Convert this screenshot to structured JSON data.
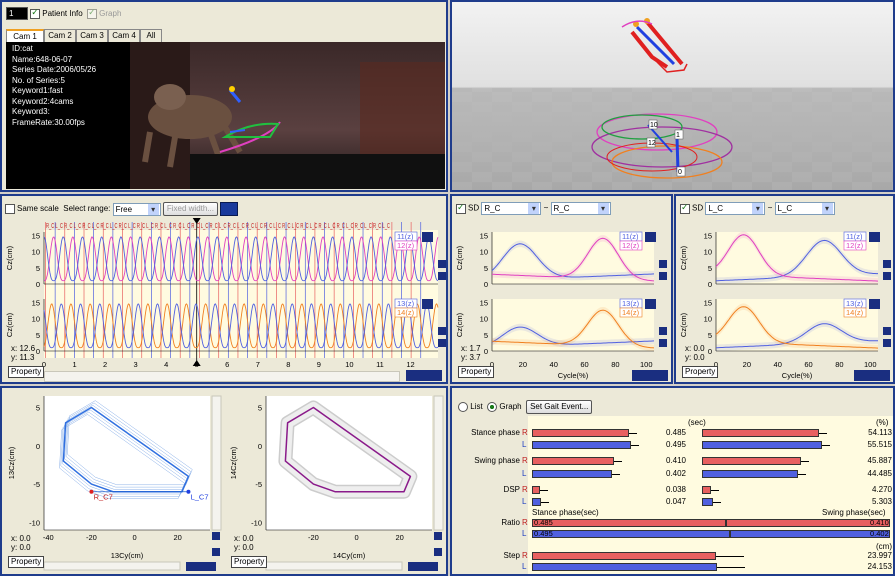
{
  "colors": {
    "accent": "#1f3c8c",
    "red": "#e86060",
    "blue": "#5060e0",
    "pink": "#e040c0",
    "orange": "#f08020",
    "green": "#20a040"
  },
  "topleft": {
    "cam_num": "1",
    "patient_info": "Patient Info",
    "graph": "Graph",
    "tabs": [
      "Cam 1",
      "Cam 2",
      "Cam 3",
      "Cam 4",
      "All"
    ],
    "info": [
      "ID:cat",
      "Name:648-06-07",
      "Series Date:2006/05/26",
      "No. of Series:5",
      "Keyword1:fast",
      "Keyword2:4cams",
      "Keyword3:",
      "FrameRate:30.00fps"
    ]
  },
  "topright": {
    "icons": [
      "refresh-icon",
      "move-icon",
      "down-arrow-icon",
      "cursor-icon"
    ],
    "labels": [
      "10",
      "1",
      "12",
      "0"
    ]
  },
  "timepane": {
    "same_scale": "Same scale",
    "select_range": "Select range:",
    "range_value": "Free",
    "fixed_width": "Fixed width...",
    "gait_label": "R_C L_C R_C L_C R_C L_C R_C L_C R_C L_C R_C L_C R_C L_C R_C L_C R_C L_C R_C L_C R_C L_C R_C L_C R_C L_C R_C L_C R_C L_C R_C L_C R_C L_C R_C L_C R_C L_C",
    "ylabel": "Cz(cm)",
    "xlabel": "Time(sec)",
    "legend_top": [
      "11(z)",
      "12(z)"
    ],
    "legend_bot": [
      "13(z)",
      "14(z)"
    ],
    "xticks": [
      "0",
      "1",
      "2",
      "3",
      "4",
      "5",
      "6",
      "7",
      "8",
      "9",
      "10",
      "11",
      "12"
    ],
    "yticks": [
      "15",
      "10",
      "5",
      "0"
    ],
    "x_readout": "x:  12.6",
    "y_readout": "y:  11.3",
    "property": "Property"
  },
  "cycleR": {
    "sd": "SD",
    "sel1": "R_C",
    "tilde": "~",
    "sel2": "R_C",
    "ylabel": "Cz(cm)",
    "xlabel": "Cycle(%)",
    "legend_top": [
      "11(z)",
      "12(z)"
    ],
    "legend_bot": [
      "13(z)",
      "14(z)"
    ],
    "xticks": [
      "0",
      "20",
      "40",
      "60",
      "80",
      "100"
    ],
    "yticks": [
      "15",
      "10",
      "5",
      "0"
    ],
    "x_readout": "x:  1.7",
    "y_readout": "y:  3.7",
    "property": "Property"
  },
  "cycleL": {
    "sd": "SD",
    "sel1": "L_C",
    "tilde": "~",
    "sel2": "L_C",
    "ylabel": "Cz(cm)",
    "xlabel": "Cycle(%)",
    "legend_top": [
      "11(z)",
      "12(z)"
    ],
    "legend_bot": [
      "13(z)",
      "14(z)"
    ],
    "xticks": [
      "0",
      "20",
      "40",
      "60",
      "80",
      "100"
    ],
    "yticks": [
      "15",
      "10",
      "5",
      "0"
    ],
    "x_readout": "x:  0.0",
    "y_readout": "y:  0.0",
    "property": "Property"
  },
  "loop1": {
    "ylabel": "13Cz(cm)",
    "xlabel": "13Cy(cm)",
    "xticks": [
      "-40",
      "-20",
      "0",
      "20"
    ],
    "yticks": [
      "5",
      "0",
      "-5",
      "-10"
    ],
    "label_r": "R_C7",
    "label_l": "L_C7",
    "x_readout": "x:  0.0",
    "y_readout": "y:  0.0",
    "property": "Property"
  },
  "loop2": {
    "ylabel": "14Cz(cm)",
    "xlabel": "14Cy(cm)",
    "xticks": [
      "-20",
      "0",
      "20"
    ],
    "yticks": [
      "5",
      "0",
      "-5",
      "-10"
    ],
    "x_readout": "x:  0.0",
    "y_readout": "y:  0.0",
    "property": "Property"
  },
  "gait": {
    "list": "List",
    "graph": "Graph",
    "set_event": "Set Gait Event...",
    "unit_sec": "(sec)",
    "unit_pct": "(%)",
    "unit_cm": "(cm)",
    "rows": [
      {
        "name": "Stance phase",
        "side": "R",
        "sec": "0.485",
        "pct": "54.113"
      },
      {
        "name": "",
        "side": "L",
        "sec": "0.495",
        "pct": "55.515"
      },
      {
        "name": "Swing phase",
        "side": "R",
        "sec": "0.410",
        "pct": "45.887"
      },
      {
        "name": "",
        "side": "L",
        "sec": "0.402",
        "pct": "44.485"
      },
      {
        "name": "DSP",
        "side": "R",
        "sec": "0.038",
        "pct": "4.270"
      },
      {
        "name": "",
        "side": "L",
        "sec": "0.047",
        "pct": "5.303"
      }
    ],
    "ratio_hdr_l": "Stance phase(sec)",
    "ratio_hdr_r": "Swing phase(sec)",
    "ratio": "Ratio",
    "ratio_rows": [
      {
        "side": "R",
        "a": "0.485",
        "b": "0.410"
      },
      {
        "side": "L",
        "a": "0.495",
        "b": "0.402"
      }
    ],
    "step": "Step",
    "step_rows": [
      {
        "side": "R",
        "v": "23.997"
      },
      {
        "side": "L",
        "v": "24.153"
      }
    ]
  }
}
